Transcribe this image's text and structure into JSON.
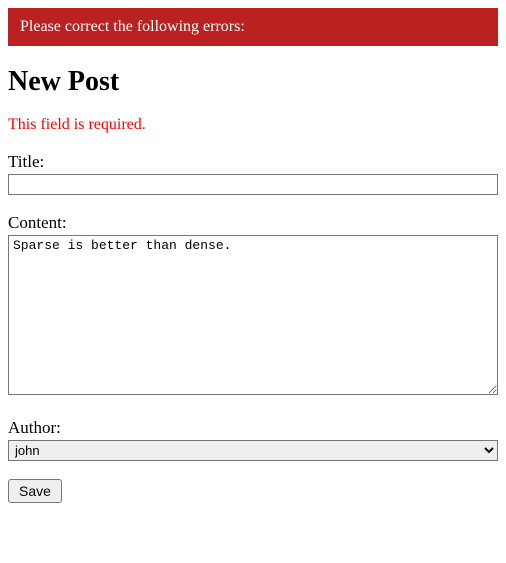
{
  "error_banner": "Please correct the following errors:",
  "page_title": "New Post",
  "field_error": "This field is required.",
  "form": {
    "title": {
      "label": "Title:",
      "value": ""
    },
    "content": {
      "label": "Content:",
      "value": "Sparse is better than dense."
    },
    "author": {
      "label": "Author:",
      "selected": "john"
    },
    "submit_label": "Save"
  }
}
